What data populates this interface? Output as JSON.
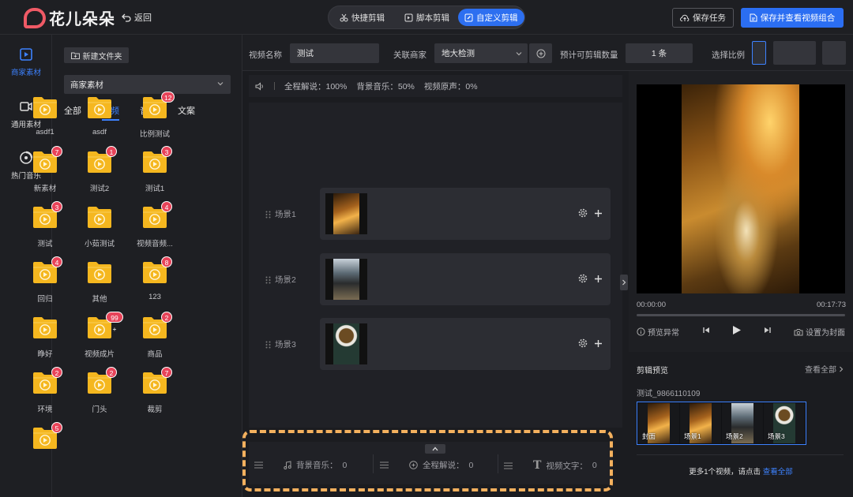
{
  "app": {
    "brand": "花儿朵朵",
    "back_label": "返回"
  },
  "modes": [
    {
      "label": "快捷剪辑",
      "icon": "scissors-icon",
      "active": false
    },
    {
      "label": "脚本剪辑",
      "icon": "script-icon",
      "active": false
    },
    {
      "label": "自定义剪辑",
      "icon": "custom-edit-icon",
      "active": true
    }
  ],
  "actions": {
    "save_task": "保存任务",
    "save_and_view": "保存并查看视频组合"
  },
  "leftnav": [
    {
      "label": "商家素材",
      "icon": "play-square-icon",
      "active": true
    },
    {
      "label": "通用素材",
      "icon": "video-camera-icon",
      "active": false
    },
    {
      "label": "热门音乐",
      "icon": "music-disc-icon",
      "active": false
    }
  ],
  "materials": {
    "new_folder": "新建文件夹",
    "source": "商家素材",
    "tabs": [
      {
        "label": "全部",
        "active": false
      },
      {
        "label": "视频",
        "active": true
      },
      {
        "label": "音频",
        "active": false
      },
      {
        "label": "文案",
        "active": false
      }
    ],
    "folders": [
      {
        "name": "asdf1",
        "badge": ""
      },
      {
        "name": "asdf",
        "badge": ""
      },
      {
        "name": "比例测试",
        "badge": "12"
      },
      {
        "name": "新素材",
        "badge": "7"
      },
      {
        "name": "测试2",
        "badge": "1"
      },
      {
        "name": "测试1",
        "badge": "3"
      },
      {
        "name": "测试",
        "badge": "3"
      },
      {
        "name": "小茹测试",
        "badge": ""
      },
      {
        "name": "视频音频...",
        "badge": "4"
      },
      {
        "name": "回归",
        "badge": "4"
      },
      {
        "name": "其他",
        "badge": ""
      },
      {
        "name": "123",
        "badge": "8"
      },
      {
        "name": "睁好",
        "badge": ""
      },
      {
        "name": "视频成片",
        "badge": "99 +"
      },
      {
        "name": "商品",
        "badge": "2"
      },
      {
        "name": "环境",
        "badge": "2"
      },
      {
        "name": "门头",
        "badge": "2"
      },
      {
        "name": "裁剪",
        "badge": "7"
      },
      {
        "name": "",
        "badge": "5"
      }
    ]
  },
  "fields": {
    "video_name_label": "视频名称",
    "video_name_value": "测试",
    "merchant_label": "关联商家",
    "merchant_value": "地大检测",
    "estimate_label": "预计可剪辑数量",
    "estimate_value": "1 条",
    "ratio_label": "选择比例"
  },
  "volume": {
    "narration": "全程解说：100%",
    "music": "背景音乐：50%",
    "original": "视频原声：0%"
  },
  "scenes": [
    {
      "label": "场景1"
    },
    {
      "label": "场景2"
    },
    {
      "label": "场景3"
    }
  ],
  "bottom": {
    "music": "背景音乐：",
    "music_count": "0",
    "narration": "全程解说：",
    "narration_count": "0",
    "text": "视频文字：",
    "text_count": "0"
  },
  "player": {
    "current_time": "00:00:00",
    "total_time": "00:17:73",
    "progress": 0,
    "preview_error": "预览异常",
    "set_cover": "设置为封面"
  },
  "clip_preview": {
    "title": "剪辑预览",
    "view_all": "查看全部",
    "clip_name": "测试_9866110109",
    "frames": [
      "封面",
      "场景1",
      "场景2",
      "场景3"
    ],
    "more_text": "更多1个视频，请点击",
    "more_link": "查看全部"
  },
  "colors": {
    "accent": "#2b6ef2",
    "badge": "#e84359",
    "folder": "#f5b71f",
    "highlight_dash": "#f4b15e"
  }
}
